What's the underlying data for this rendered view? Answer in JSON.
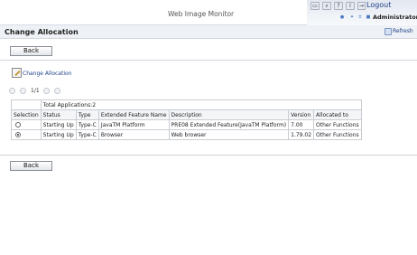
{
  "header": {
    "app_title": "Web Image Monitor",
    "logout_label": "Logout",
    "user_label": "Administrator",
    "icons": [
      "keyboard-icon",
      "search-icon",
      "help-icon",
      "info-icon",
      "logout-icon"
    ]
  },
  "page": {
    "title": "Change Allocation",
    "refresh_label": "Refresh"
  },
  "actions": {
    "back_label": "Back",
    "change_allocation_label": "Change Allocation"
  },
  "pager": {
    "page_text": "1/1"
  },
  "table": {
    "total_label": "Total Applications:2",
    "columns": [
      "Selection",
      "Status",
      "Type",
      "Extended Feature Name",
      "Description",
      "Version",
      "Allocated to"
    ],
    "rows": [
      {
        "selected": false,
        "status": "Starting Up",
        "type": "Type-C",
        "name": "JavaTM Platform",
        "description": "PRE08 Extended Feature(JavaTM Platform)",
        "version": "7.00",
        "allocated_to": "Other Functions"
      },
      {
        "selected": true,
        "status": "Starting Up",
        "type": "Type-C",
        "name": "Browser",
        "description": "Web browser",
        "version": "1.79.02",
        "allocated_to": "Other Functions"
      }
    ]
  }
}
